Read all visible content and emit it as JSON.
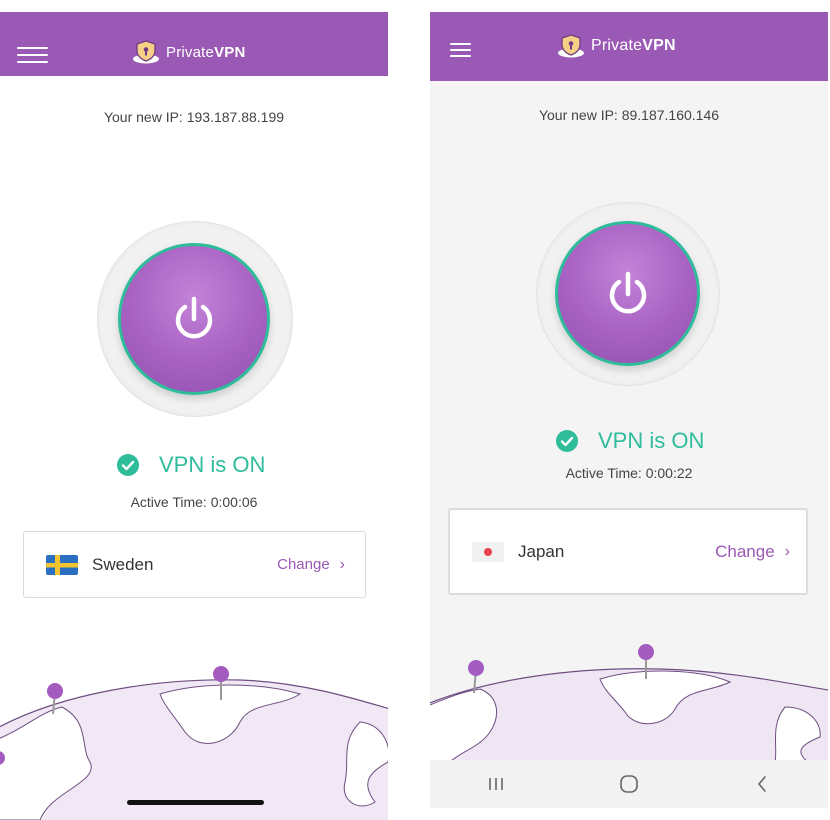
{
  "colors": {
    "brand": "#9b59b6",
    "accent_green": "#2fbc9b"
  },
  "left": {
    "brand": {
      "prefix": "Private",
      "suffix": "VPN"
    },
    "ip_text": "Your new IP: 193.187.88.199",
    "status": "VPN is ON",
    "active_time": "Active Time: 0:00:06",
    "country": {
      "name": "Sweden",
      "flag_icon": "sweden-flag-icon"
    },
    "change_label": "Change"
  },
  "right": {
    "brand": {
      "prefix": "Private",
      "suffix": "VPN"
    },
    "ip_text": "Your new IP: 89.187.160.146",
    "status": "VPN is ON",
    "active_time": "Active Time: 0:00:22",
    "country": {
      "name": "Japan",
      "flag_icon": "japan-flag-icon"
    },
    "change_label": "Change",
    "nav": {
      "recents_icon": "recents-icon",
      "home_icon": "home-icon",
      "back_icon": "back-icon"
    }
  }
}
